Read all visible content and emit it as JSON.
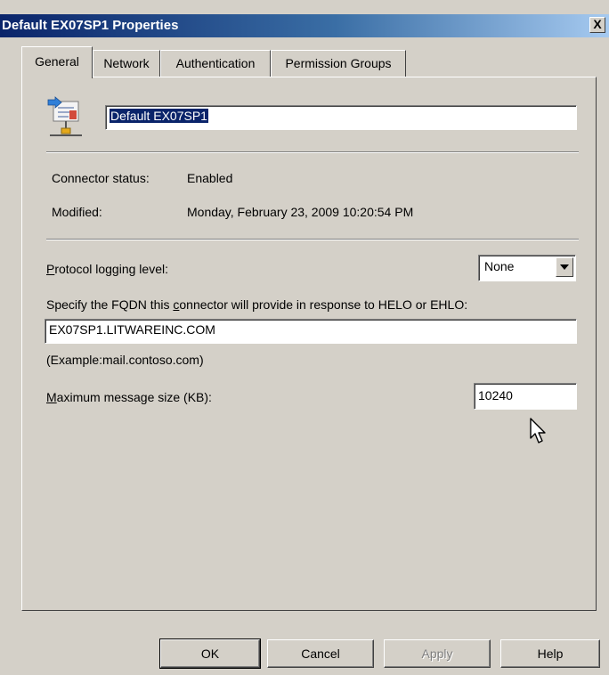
{
  "window": {
    "title": "Default EX07SP1 Properties",
    "close_label": "X"
  },
  "tabs": [
    {
      "label": "General",
      "active": true
    },
    {
      "label": "Network",
      "active": false
    },
    {
      "label": "Authentication",
      "active": false
    },
    {
      "label": "Permission Groups",
      "active": false
    }
  ],
  "general": {
    "icon": "connector-envelope-icon",
    "name_value": "Default EX07SP1",
    "connector_status_label": "Connector status:",
    "connector_status_value": "Enabled",
    "modified_label": "Modified:",
    "modified_value": "Monday, February 23, 2009 10:20:54 PM",
    "protocol_logging_label_accel": "P",
    "protocol_logging_label_rest": "rotocol logging level:",
    "protocol_logging_value": "None",
    "fqdn_label_pre": "Specify the FQDN this ",
    "fqdn_label_accel": "c",
    "fqdn_label_post": "onnector will provide in response to HELO or EHLO:",
    "fqdn_value": "EX07SP1.LITWAREINC.COM",
    "fqdn_example": "(Example:mail.contoso.com)",
    "max_size_label_accel": "M",
    "max_size_label_rest": "aximum message size (KB):",
    "max_size_value": "10240"
  },
  "buttons": {
    "ok": "OK",
    "cancel": "Cancel",
    "apply": "Apply",
    "help": "Help"
  },
  "colors": {
    "titlebar_start": "#0a246a",
    "titlebar_end": "#a6caf0",
    "dialog_face": "#d4d0c8",
    "selection": "#0a246a"
  }
}
